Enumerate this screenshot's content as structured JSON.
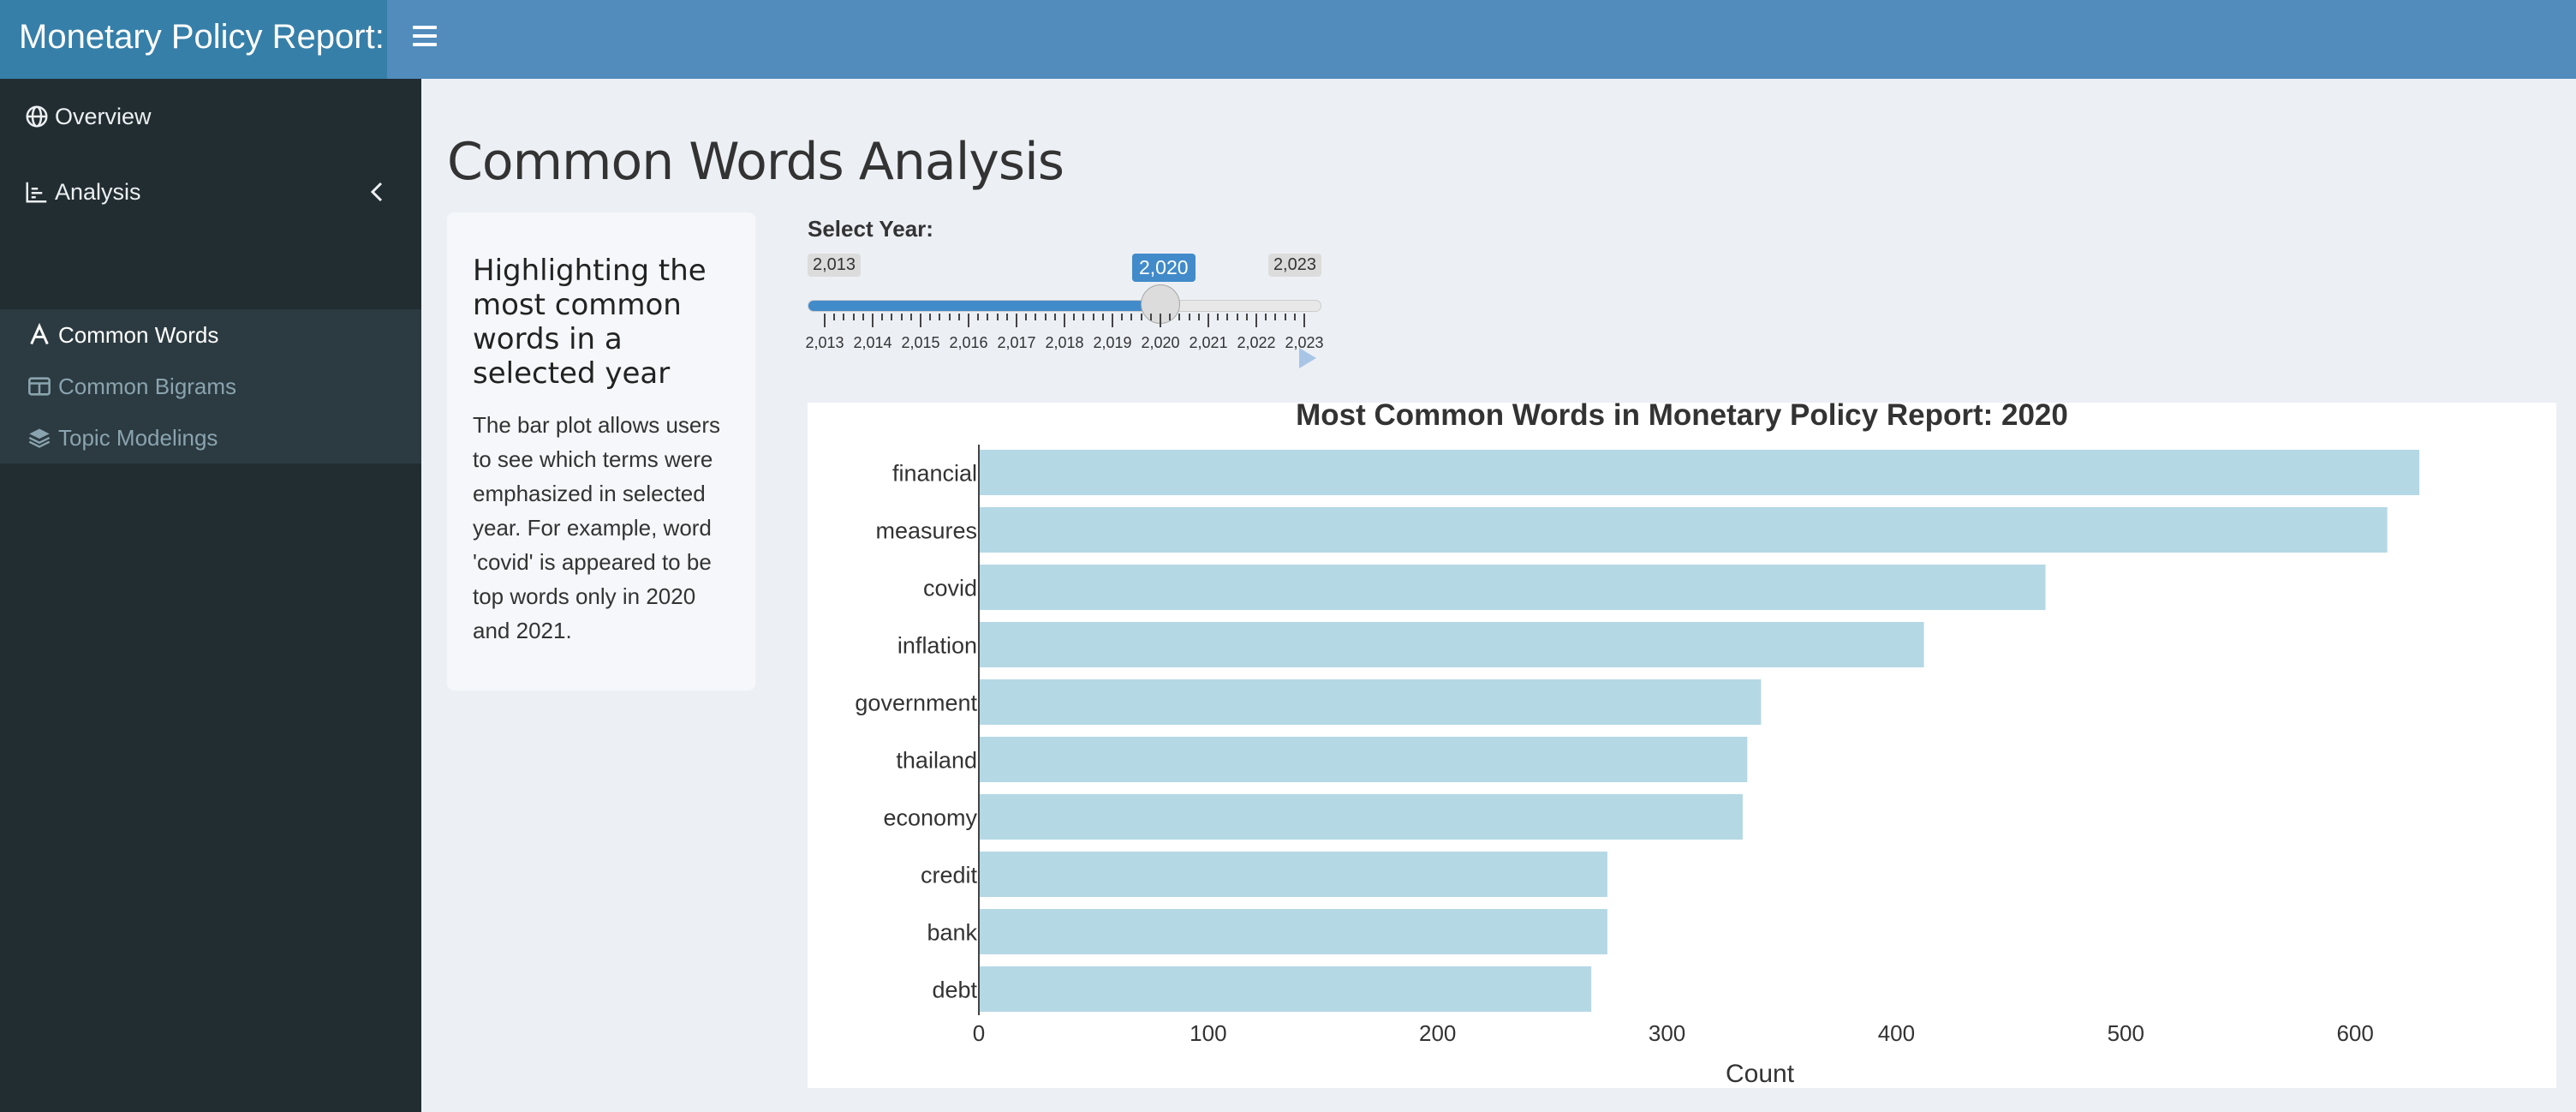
{
  "app": {
    "title": "Monetary Policy Report:"
  },
  "sidebar": {
    "items": [
      {
        "label": "Overview",
        "icon": "globe-icon"
      },
      {
        "label": "Analysis",
        "icon": "chart-icon"
      }
    ],
    "subitems": [
      {
        "label": "Common Words",
        "icon": "font-icon",
        "active": true
      },
      {
        "label": "Common Bigrams",
        "icon": "columns-icon"
      },
      {
        "label": "Topic Modelings",
        "icon": "layers-icon"
      }
    ]
  },
  "page": {
    "title": "Common Words Analysis"
  },
  "panel": {
    "heading": "Highlighting the most common words in a selected year",
    "body": "The bar plot allows users to see which terms were emphasized in selected year. For example, word 'covid' is appeared to be top words only in 2020 and 2021."
  },
  "slider": {
    "label": "Select Year:",
    "min": 2013,
    "max": 2023,
    "value": 2020,
    "min_label": "2,013",
    "max_label": "2,023",
    "value_label": "2,020",
    "tick_labels": [
      "2,013",
      "2,014",
      "2,015",
      "2,016",
      "2,017",
      "2,018",
      "2,019",
      "2,020",
      "2,021",
      "2,022",
      "2,023"
    ]
  },
  "chart_data": {
    "type": "bar",
    "orientation": "horizontal",
    "title": "Most Common Words in Monetary Policy Report: 2020",
    "xlabel": "Count",
    "ylabel": "",
    "categories": [
      "financial",
      "measures",
      "covid",
      "inflation",
      "government",
      "thailand",
      "economy",
      "credit",
      "bank",
      "debt"
    ],
    "values": [
      628,
      614,
      465,
      412,
      341,
      335,
      333,
      274,
      274,
      267
    ],
    "xlim": [
      0,
      672
    ],
    "xticks": [
      0,
      100,
      200,
      300,
      400,
      500,
      600
    ],
    "bar_color": "#b5d8e5"
  }
}
